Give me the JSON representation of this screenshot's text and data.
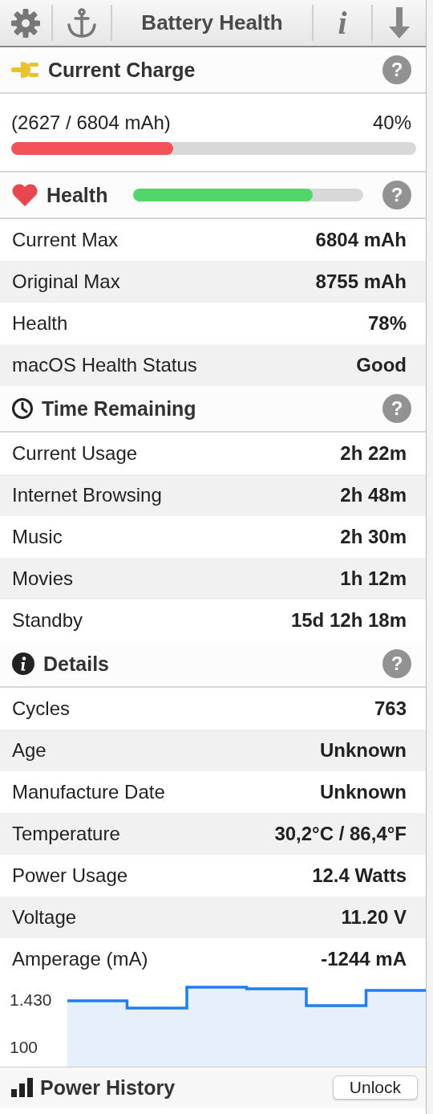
{
  "toolbar": {
    "title": "Battery Health",
    "info_glyph": "i"
  },
  "current_charge": {
    "title": "Current Charge",
    "help": "?",
    "reading": "(2627 / 6804 mAh)",
    "percent": "40%",
    "level": 0.4
  },
  "health": {
    "title": "Health",
    "help": "?",
    "level": 0.78,
    "rows": [
      {
        "label": "Current Max",
        "value": "6804 mAh"
      },
      {
        "label": "Original Max",
        "value": "8755 mAh"
      },
      {
        "label": "Health",
        "value": "78%"
      },
      {
        "label": "macOS Health Status",
        "value": "Good"
      }
    ]
  },
  "time_remaining": {
    "title": "Time Remaining",
    "help": "?",
    "rows": [
      {
        "label": "Current Usage",
        "value": "2h 22m"
      },
      {
        "label": "Internet Browsing",
        "value": "2h 48m"
      },
      {
        "label": "Music",
        "value": "2h 30m"
      },
      {
        "label": "Movies",
        "value": "1h 12m"
      },
      {
        "label": "Standby",
        "value": "15d 12h 18m"
      }
    ]
  },
  "details": {
    "title": "Details",
    "help": "?",
    "rows": [
      {
        "label": "Cycles",
        "value": "763"
      },
      {
        "label": "Age",
        "value": "Unknown"
      },
      {
        "label": "Manufacture Date",
        "value": "Unknown"
      },
      {
        "label": "Temperature",
        "value": "30,2°C / 86,4°F"
      },
      {
        "label": "Power Usage",
        "value": "12.4 Watts"
      },
      {
        "label": "Voltage",
        "value": "11.20 V"
      },
      {
        "label": "Amperage (mA)",
        "value": "-1244 mA"
      }
    ],
    "axis_labels": [
      "1.430",
      "100"
    ]
  },
  "footer": {
    "title": "Power History",
    "button": "Unlock"
  }
}
